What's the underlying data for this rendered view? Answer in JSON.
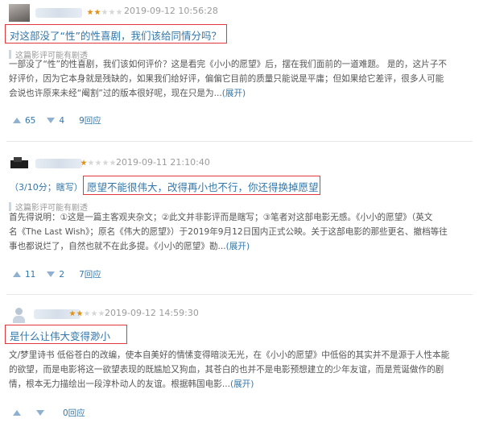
{
  "reviews": [
    {
      "stars": 2,
      "time": "2019-09-12 10:56:28",
      "title": "对这部没了“性”的性喜剧，我们该给同情分吗？",
      "spoiler": "这篇影评可能有剧透",
      "body_lines": [
        "一部没了“性”的性喜剧，我们该如何评价？这是看完《小小的愿望》后，摆在我们面前的一道难题。 是的，这片子不",
        "好评价，因为它本身就是残缺的，如果我们给好评，偏偏它目前的质量只能说是平庸；但如果给它差评，很多人可能",
        "会说也许原来未经“阉割”过的版本很好呢，现在只是为..."
      ],
      "expand": "(展开)",
      "up": "65",
      "down": "4",
      "replies": "9回应"
    },
    {
      "stars": 1,
      "time": "2019-09-11 21:10:40",
      "prefix": "（3/10分；瞎写）",
      "title": "愿望不能很伟大，改得再小也不行，你还得换掉愿望",
      "spoiler": "这篇影评可能有剧透",
      "body_lines": [
        "首先得说明：①这是一篇主客观夹杂文；②此文并非影评而是瞎写；③笔者对这部电影无感。《小小的愿望》（英文",
        "名《The Last Wish》；原名《伟大的愿望》）于2019年9月12日国内正式公映。关于这部电影的那些更名、撤档等往",
        "事也都说烂了，自然也就不在此多提。《小小的愿望》勘..."
      ],
      "expand": "(展开)",
      "up": "11",
      "down": "2",
      "replies": "7回应"
    },
    {
      "stars": 2,
      "time": "2019-09-12 14:59:30",
      "title": "是什么让伟大变得渺小",
      "body_lines": [
        "文/梦里诗书 低俗苍白的改编，使本自美好的情愫变得暗淡无光，在《小小的愿望》中低俗的其实并不是源于人性本能",
        "的欲望，而是电影将这一欲望表现的既尴尬又狗血，其苍白的也并不是电影预想建立的少年友谊，而是荒诞做作的剧",
        "情，根本无力描绘出一段淳朴动人的友谊。根据韩国电影..."
      ],
      "expand": "(展开)",
      "up": "",
      "down": "",
      "replies": "0回应"
    }
  ],
  "icons": {
    "up": "thumb-up-triangle-icon",
    "down": "thumb-down-triangle-icon",
    "star": "star-icon"
  },
  "colors": {
    "link": "#3377aa",
    "highlight_box": "#e0383d",
    "star_on": "#e09015",
    "star_off": "#d6d6d6"
  }
}
